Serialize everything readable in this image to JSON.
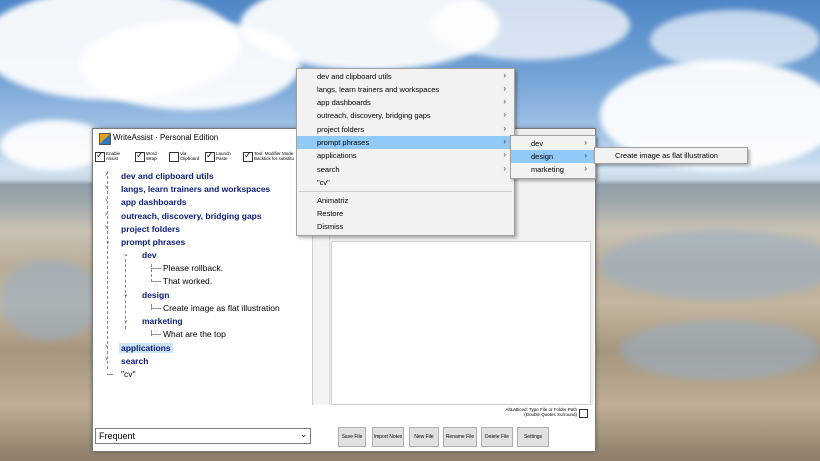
{
  "window": {
    "title": "WriteAssist · Personal Edition",
    "options": [
      {
        "label": "Enable\nAssist",
        "checked": true
      },
      {
        "label": "Word\nWrap",
        "checked": true
      },
      {
        "label": "Via\nClipboard",
        "checked": false
      },
      {
        "label": "Launch\nPaste",
        "checked": true
      },
      {
        "label": "Tool: Modifier Mode\nBacktick for substitu",
        "checked": true
      }
    ]
  },
  "tree": [
    {
      "label": "dev and clipboard utils",
      "bold": true
    },
    {
      "label": "langs, learn trainers and workspaces",
      "bold": true
    },
    {
      "label": "app dashboards",
      "bold": true
    },
    {
      "label": "outreach, discovery, bridging gaps",
      "bold": true
    },
    {
      "label": "project folders",
      "bold": true
    },
    {
      "label": "prompt phrases",
      "bold": true
    },
    {
      "label": "dev",
      "bold": true
    },
    {
      "label": "Please rollback.",
      "bold": false
    },
    {
      "label": "That worked.",
      "bold": false
    },
    {
      "label": "design",
      "bold": true
    },
    {
      "label": "Create image as flat illustration",
      "bold": false
    },
    {
      "label": "marketing",
      "bold": true
    },
    {
      "label": "What are the top",
      "bold": false
    },
    {
      "label": "applications",
      "bold": true
    },
    {
      "label": "search",
      "bold": true
    },
    {
      "label": "\"cv\"",
      "bold": false
    }
  ],
  "footer": {
    "combo_value": "Frequent",
    "note": "AltLatticed: Type File or Folder Path (Double Quotes Surround)",
    "buttons": [
      "Save File",
      "Import Notes",
      "New File",
      "Rename File",
      "Delete File",
      "Settings"
    ]
  },
  "menu_main": {
    "items": [
      {
        "label": "dev and clipboard utils",
        "arrow": "›"
      },
      {
        "label": "langs, learn trainers and workspaces",
        "arrow": "›"
      },
      {
        "label": "app dashboards",
        "arrow": "›"
      },
      {
        "label": "outreach, discovery, bridging gaps",
        "arrow": "›"
      },
      {
        "label": "project folders",
        "arrow": "›"
      },
      {
        "label": "prompt phrases",
        "arrow": "›"
      },
      {
        "label": "applications",
        "arrow": "›"
      },
      {
        "label": "search",
        "arrow": "›"
      },
      {
        "label": "\"cv\"",
        "arrow": ""
      }
    ],
    "extra": [
      "Animatriz",
      "Restore",
      "Dismiss"
    ]
  },
  "menu_sub": {
    "items": [
      {
        "label": "dev",
        "arrow": "›"
      },
      {
        "label": "design",
        "arrow": "›"
      },
      {
        "label": "marketing",
        "arrow": "›"
      }
    ]
  },
  "menu_sub2": {
    "items": [
      {
        "label": "Create image as flat illustration"
      }
    ]
  }
}
